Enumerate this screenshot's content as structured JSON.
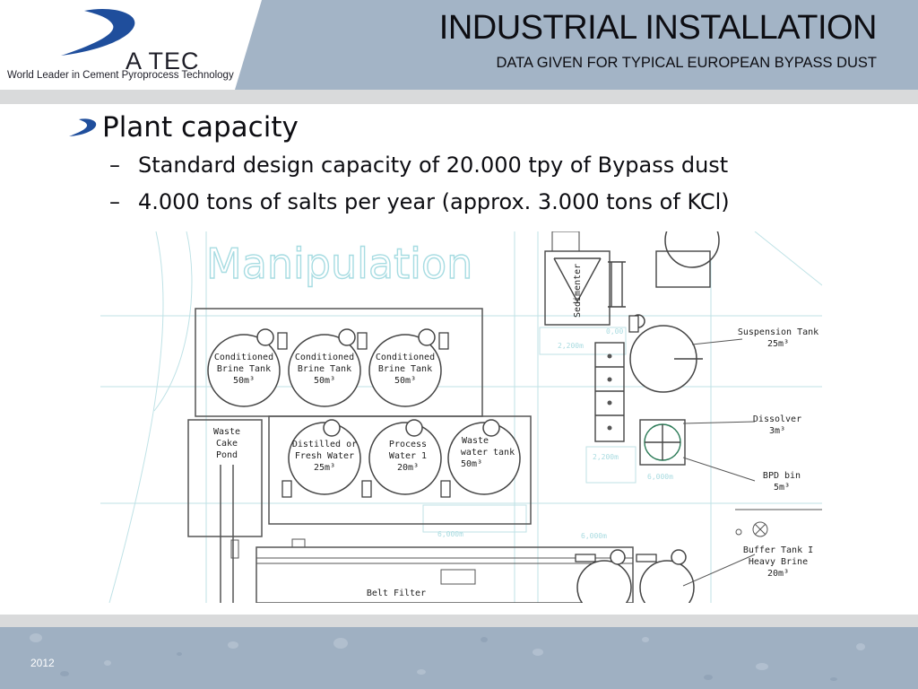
{
  "header": {
    "title": "INDUSTRIAL INSTALLATION",
    "subtitle": "DATA GIVEN FOR TYPICAL EUROPEAN BYPASS DUST",
    "logo_wordmark": "A TEC",
    "logo_tagline": "World Leader in Cement Pyroprocess Technology",
    "colors": {
      "header_band": "#a3b4c6",
      "logo_swoosh": "#1f4e9c",
      "rule": "#d9dadb"
    }
  },
  "content": {
    "bullet_icon": "swoosh-bullet-icon",
    "heading": "Plant capacity",
    "items": [
      {
        "dash": "–",
        "text": "Standard design capacity of 20.000 tpy of Bypass dust"
      },
      {
        "dash": "–",
        "text": "4.000 tons of salts per year (approx. 3.000 tons of KCl)"
      }
    ]
  },
  "plan": {
    "area_label": "Manipulation",
    "tanks": [
      {
        "line1": "Conditioned",
        "line2": "Brine Tank",
        "line3": "50m³"
      },
      {
        "line1": "Conditioned",
        "line2": "Brine Tank",
        "line3": "50m³"
      },
      {
        "line1": "Conditioned",
        "line2": "Brine Tank",
        "line3": "50m³"
      },
      {
        "line1": "Distilled or",
        "line2": "Fresh Water",
        "line3": "25m³"
      },
      {
        "line1": "Process",
        "line2": "Water 1",
        "line3": "20m³"
      },
      {
        "line1": "Waste",
        "line2": "water tank",
        "line3": "50m³"
      }
    ],
    "pond": {
      "line1": "Waste",
      "line2": "Cake",
      "line3": "Pond"
    },
    "belt_filter": "Belt Filter",
    "sedimenter": "Sedimenter",
    "callouts": [
      {
        "line1": "Suspension Tank",
        "line2": "25m³"
      },
      {
        "line1": "Dissolver",
        "line2": "3m³"
      },
      {
        "line1": "BPD bin",
        "line2": "5m³"
      },
      {
        "line1": "Buffer Tank I",
        "line2": "Heavy Brine",
        "line3": "20m³"
      }
    ],
    "dimensions": [
      "2,200m",
      "0,00",
      "2,200m",
      "6,000m",
      "6,000m",
      "6,000m"
    ]
  },
  "footer": {
    "year": "2012"
  }
}
